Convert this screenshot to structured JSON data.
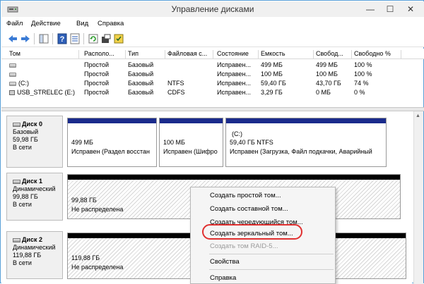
{
  "window": {
    "title": "Управление дисками",
    "controls": {
      "minimize": "—",
      "maximize": "☐",
      "close": "✕"
    }
  },
  "menu": [
    "Файл",
    "Действие",
    "Вид",
    "Справка"
  ],
  "toolbar": {
    "icons": [
      "back-arrow-icon",
      "forward-arrow-icon",
      "console-tree-icon",
      "help-icon",
      "properties-icon",
      "refresh-icon",
      "export-icon",
      "settings-icon"
    ]
  },
  "volume_list": {
    "headers": [
      "Том",
      "Располо...",
      "Тип",
      "Файловая с...",
      "Состояние",
      "Емкость",
      "Свобод...",
      "Свободно %"
    ],
    "rows": [
      {
        "name": "",
        "layout": "Простой",
        "type": "Базовый",
        "fs": "",
        "status": "Исправен...",
        "capacity": "499 МБ",
        "free": "499 МБ",
        "free_pct": "100 %"
      },
      {
        "name": "",
        "layout": "Простой",
        "type": "Базовый",
        "fs": "",
        "status": "Исправен...",
        "capacity": "100 МБ",
        "free": "100 МБ",
        "free_pct": "100 %"
      },
      {
        "name": "(C:)",
        "layout": "Простой",
        "type": "Базовый",
        "fs": "NTFS",
        "status": "Исправен...",
        "capacity": "59,40 ГБ",
        "free": "43,70 ГБ",
        "free_pct": "74 %"
      },
      {
        "name": "USB_STRELEC (E:)",
        "layout": "Простой",
        "type": "Базовый",
        "fs": "CDFS",
        "status": "Исправен...",
        "capacity": "3,29 ГБ",
        "free": "0 МБ",
        "free_pct": "0 %"
      }
    ]
  },
  "disks": [
    {
      "name": "Диск 0",
      "type": "Базовый",
      "size": "59,98 ГБ",
      "state": "В сети",
      "partitions": [
        {
          "title": "",
          "size": "499 МБ",
          "status": "Исправен (Раздел восстан"
        },
        {
          "title": "",
          "size": "100 МБ",
          "status": "Исправен (Шифро"
        },
        {
          "title": "(C:)",
          "size": "59,40 ГБ NTFS",
          "status": "Исправен (Загрузка, Файл подкачки, Аварийный"
        }
      ]
    },
    {
      "name": "Диск 1",
      "type": "Динамический",
      "size": "99,88 ГБ",
      "state": "В сети",
      "unallocated": {
        "size": "99,88 ГБ",
        "status": "Не распределена"
      }
    },
    {
      "name": "Диск 2",
      "type": "Динамический",
      "size": "119,88 ГБ",
      "state": "В сети",
      "unallocated": {
        "size": "119,88 ГБ",
        "status": "Не распределена"
      }
    }
  ],
  "context_menu": {
    "items": [
      {
        "label": "Создать простой том...",
        "enabled": true
      },
      {
        "label": "Создать составной том...",
        "enabled": true
      },
      {
        "label": "Создать чередующийся том...",
        "enabled": true
      },
      {
        "label": "Создать зеркальный том...",
        "enabled": true,
        "highlighted": true
      },
      {
        "label": "Создать том RAID-5...",
        "enabled": false
      },
      {
        "label": "Свойства",
        "enabled": true
      },
      {
        "label": "Справка",
        "enabled": true
      }
    ]
  },
  "colors": {
    "primary_partition_bar": "#1a2b8c",
    "unallocated_bar": "#000000",
    "highlight_ring": "#e03030",
    "window_border": "#5aa0d8"
  }
}
